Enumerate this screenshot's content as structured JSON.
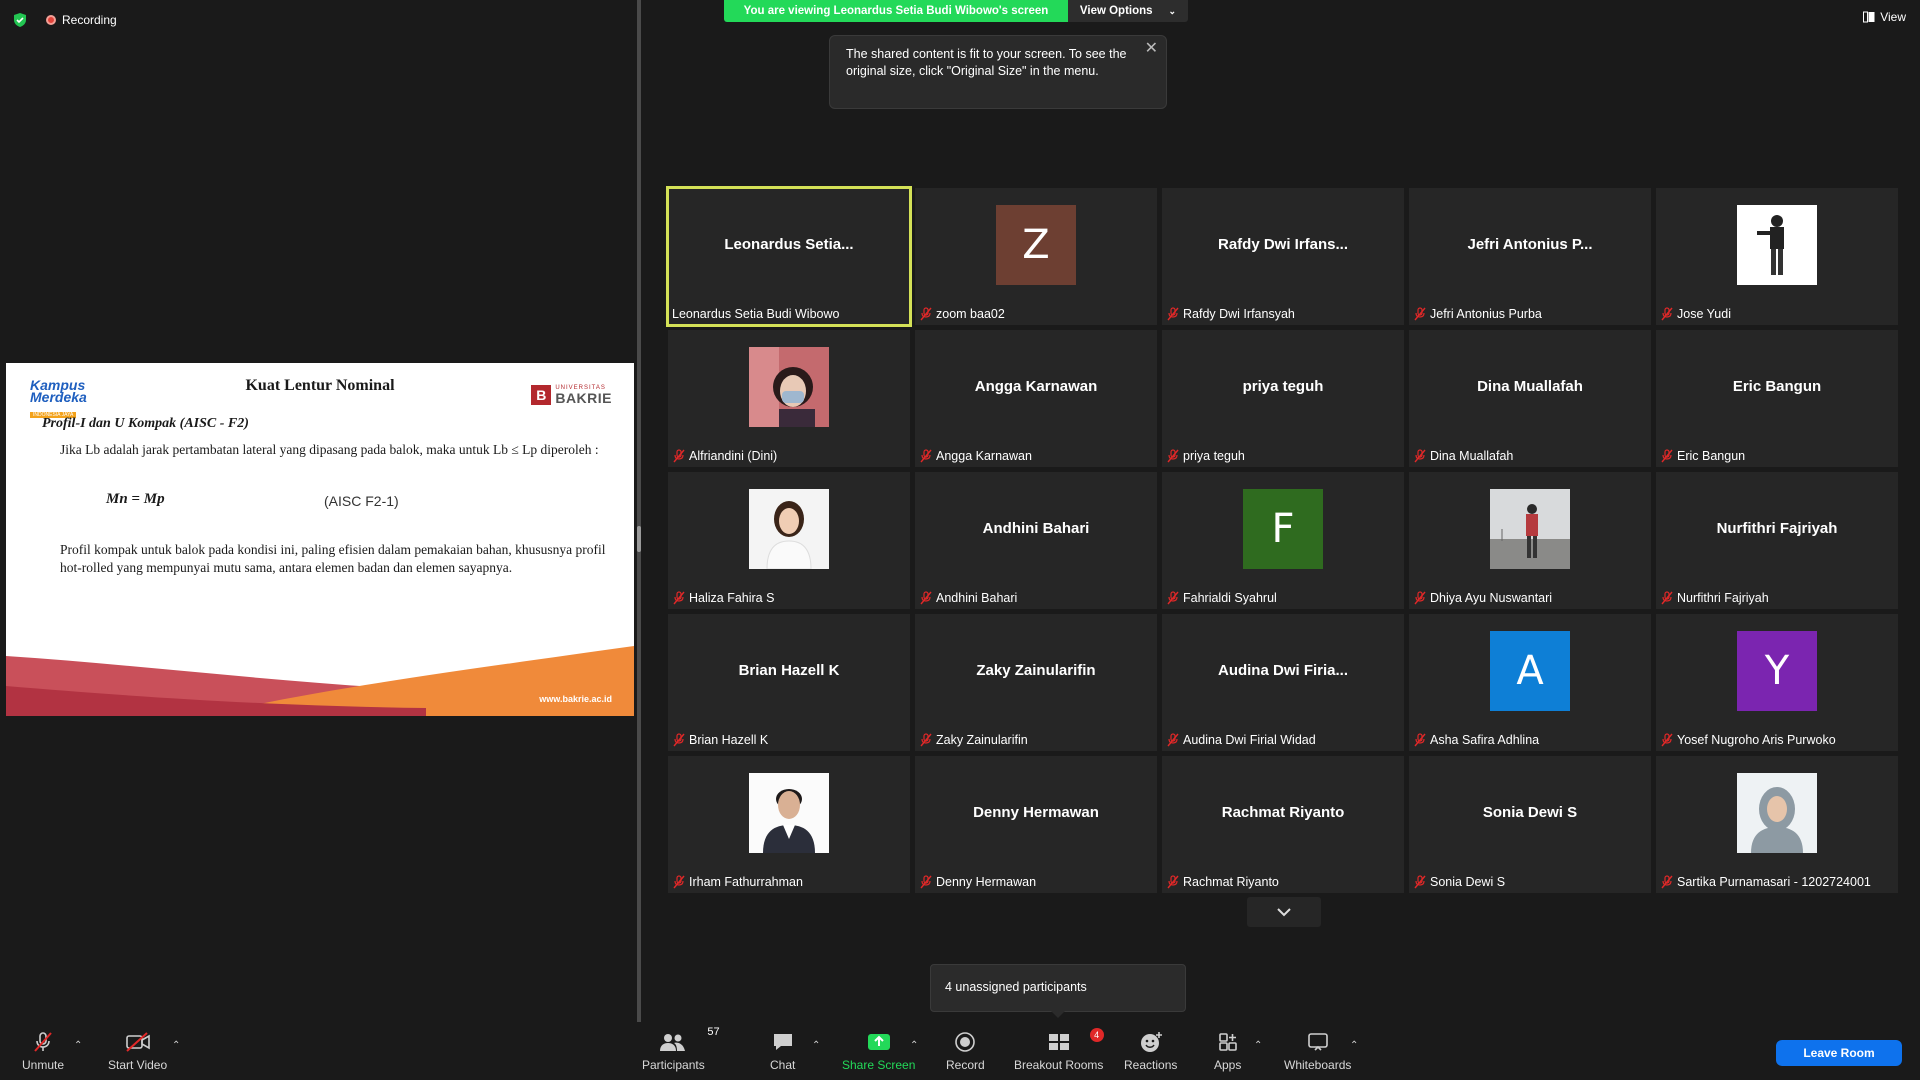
{
  "top_left": {
    "recording_label": "Recording"
  },
  "banner": {
    "viewing_text": "You are viewing Leonardus Setia Budi Wibowo's screen",
    "view_options_label": "View Options"
  },
  "tooltip": {
    "text": "The shared content is fit to your screen. To see the original size, click \"Original Size\" in the menu."
  },
  "view_button": {
    "label": "View"
  },
  "slide": {
    "title": "Kuat Lentur Nominal",
    "subtitle": "Profil-I dan U Kompak (AISC - F2)",
    "para1": "Jika Lb adalah jarak pertambatan lateral yang dipasang pada balok, maka untuk Lb ≤ Lp diperoleh :",
    "formula": "Mn = Mp",
    "ref": "(AISC F2-1)",
    "para2": "Profil kompak untuk balok pada kondisi ini, paling efisien dalam pemakaian bahan, khususnya profil hot-rolled yang mempunyai mutu sama, antara elemen badan dan elemen sayapnya.",
    "url": "www.bakrie.ac.id",
    "logo_left": "Kampus Merdeka",
    "logo_left_tag": "INDONESIA JAYA",
    "logo_right_small": "UNIVERSITAS",
    "logo_right_big": "BAKRIE"
  },
  "participants": [
    {
      "big": "Leonardus  Setia...",
      "name": "Leonardus Setia Budi Wibowo",
      "type": "text",
      "active": true,
      "muted": false
    },
    {
      "letter": "Z",
      "color": "#6d3f32",
      "name": "zoom baa02",
      "type": "letter",
      "muted": true
    },
    {
      "big": "Rafdy  Dwi  Irfans...",
      "name": "Rafdy Dwi Irfansyah",
      "type": "text",
      "muted": true
    },
    {
      "big": "Jefri  Antonius  P...",
      "name": "Jefri Antonius Purba",
      "type": "text",
      "muted": true
    },
    {
      "photo": "man-standing",
      "name": "Jose Yudi",
      "type": "photo",
      "muted": true
    },
    {
      "photo": "woman-mask",
      "name": "Alfriandini (Dini)",
      "type": "photo",
      "muted": true
    },
    {
      "big": "Angga Karnawan",
      "name": "Angga Karnawan",
      "type": "text",
      "muted": true
    },
    {
      "big": "priya teguh",
      "name": "priya teguh",
      "type": "text",
      "muted": true
    },
    {
      "big": "Dina Muallafah",
      "name": "Dina Muallafah",
      "type": "text",
      "muted": true
    },
    {
      "big": "Eric Bangun",
      "name": "Eric Bangun",
      "type": "text",
      "muted": true
    },
    {
      "photo": "woman-portrait",
      "name": "Haliza Fahira S",
      "type": "photo",
      "muted": true
    },
    {
      "big": "Andhini Bahari",
      "name": "Andhini Bahari",
      "type": "text",
      "muted": true
    },
    {
      "letter": "F",
      "color": "#2f6b1f",
      "name": "Fahrialdi Syahrul",
      "type": "letter",
      "muted": true
    },
    {
      "photo": "person-outdoor",
      "name": "Dhiya Ayu Nuswantari",
      "type": "photo",
      "muted": true
    },
    {
      "big": "Nurfithri Fajriyah",
      "name": "Nurfithri Fajriyah",
      "type": "text",
      "muted": true
    },
    {
      "big": "Brian Hazell K",
      "name": "Brian Hazell K",
      "type": "text",
      "muted": true
    },
    {
      "big": "Zaky Zainularifin",
      "name": "Zaky Zainularifin",
      "type": "text",
      "muted": true
    },
    {
      "big": "Audina  Dwi  Firia...",
      "name": "Audina Dwi Firial Widad",
      "type": "text",
      "muted": true
    },
    {
      "letter": "A",
      "color": "#0e7fd6",
      "name": "Asha Safira Adhlina",
      "type": "letter",
      "muted": true
    },
    {
      "letter": "Y",
      "color": "#7b25b0",
      "name": "Yosef Nugroho Aris Purwoko",
      "type": "letter",
      "muted": true
    },
    {
      "photo": "man-portrait",
      "name": "Irham Fathurrahman",
      "type": "photo",
      "muted": true
    },
    {
      "big": "Denny Hermawan",
      "name": "Denny Hermawan",
      "type": "text",
      "muted": true
    },
    {
      "big": "Rachmat Riyanto",
      "name": "Rachmat Riyanto",
      "type": "text",
      "muted": true
    },
    {
      "big": "Sonia Dewi S",
      "name": "Sonia Dewi S",
      "type": "text",
      "muted": true
    },
    {
      "photo": "woman-hijab",
      "name": "Sartika Purnamasari - 1202724001",
      "type": "photo",
      "muted": true
    }
  ],
  "unassigned": {
    "text": "4 unassigned participants"
  },
  "toolbar": {
    "unmute": "Unmute",
    "start_video": "Start Video",
    "participants": "Participants",
    "participants_count": "57",
    "chat": "Chat",
    "share_screen": "Share Screen",
    "record": "Record",
    "breakout_rooms": "Breakout Rooms",
    "breakout_badge": "4",
    "reactions": "Reactions",
    "apps": "Apps",
    "whiteboards": "Whiteboards",
    "leave_room": "Leave Room"
  },
  "colors": {
    "active_speaker": "#d4e157",
    "share_green": "#23d959",
    "leave_blue": "#0e72ed",
    "muted_red": "#e02828"
  }
}
